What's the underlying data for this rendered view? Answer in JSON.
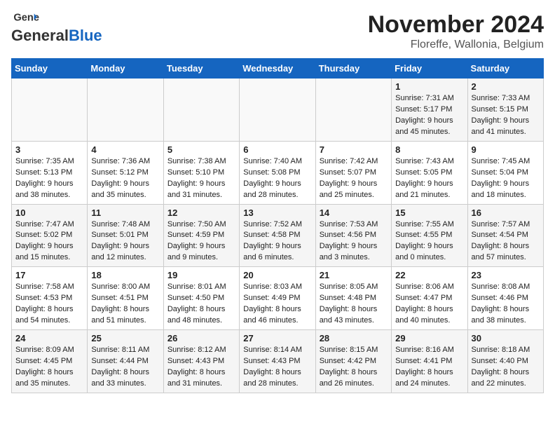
{
  "logo": {
    "general": "General",
    "blue": "Blue"
  },
  "title": "November 2024",
  "location": "Floreffe, Wallonia, Belgium",
  "days_of_week": [
    "Sunday",
    "Monday",
    "Tuesday",
    "Wednesday",
    "Thursday",
    "Friday",
    "Saturday"
  ],
  "weeks": [
    [
      {
        "day": "",
        "content": ""
      },
      {
        "day": "",
        "content": ""
      },
      {
        "day": "",
        "content": ""
      },
      {
        "day": "",
        "content": ""
      },
      {
        "day": "",
        "content": ""
      },
      {
        "day": "1",
        "content": "Sunrise: 7:31 AM\nSunset: 5:17 PM\nDaylight: 9 hours and 45 minutes."
      },
      {
        "day": "2",
        "content": "Sunrise: 7:33 AM\nSunset: 5:15 PM\nDaylight: 9 hours and 41 minutes."
      }
    ],
    [
      {
        "day": "3",
        "content": "Sunrise: 7:35 AM\nSunset: 5:13 PM\nDaylight: 9 hours and 38 minutes."
      },
      {
        "day": "4",
        "content": "Sunrise: 7:36 AM\nSunset: 5:12 PM\nDaylight: 9 hours and 35 minutes."
      },
      {
        "day": "5",
        "content": "Sunrise: 7:38 AM\nSunset: 5:10 PM\nDaylight: 9 hours and 31 minutes."
      },
      {
        "day": "6",
        "content": "Sunrise: 7:40 AM\nSunset: 5:08 PM\nDaylight: 9 hours and 28 minutes."
      },
      {
        "day": "7",
        "content": "Sunrise: 7:42 AM\nSunset: 5:07 PM\nDaylight: 9 hours and 25 minutes."
      },
      {
        "day": "8",
        "content": "Sunrise: 7:43 AM\nSunset: 5:05 PM\nDaylight: 9 hours and 21 minutes."
      },
      {
        "day": "9",
        "content": "Sunrise: 7:45 AM\nSunset: 5:04 PM\nDaylight: 9 hours and 18 minutes."
      }
    ],
    [
      {
        "day": "10",
        "content": "Sunrise: 7:47 AM\nSunset: 5:02 PM\nDaylight: 9 hours and 15 minutes."
      },
      {
        "day": "11",
        "content": "Sunrise: 7:48 AM\nSunset: 5:01 PM\nDaylight: 9 hours and 12 minutes."
      },
      {
        "day": "12",
        "content": "Sunrise: 7:50 AM\nSunset: 4:59 PM\nDaylight: 9 hours and 9 minutes."
      },
      {
        "day": "13",
        "content": "Sunrise: 7:52 AM\nSunset: 4:58 PM\nDaylight: 9 hours and 6 minutes."
      },
      {
        "day": "14",
        "content": "Sunrise: 7:53 AM\nSunset: 4:56 PM\nDaylight: 9 hours and 3 minutes."
      },
      {
        "day": "15",
        "content": "Sunrise: 7:55 AM\nSunset: 4:55 PM\nDaylight: 9 hours and 0 minutes."
      },
      {
        "day": "16",
        "content": "Sunrise: 7:57 AM\nSunset: 4:54 PM\nDaylight: 8 hours and 57 minutes."
      }
    ],
    [
      {
        "day": "17",
        "content": "Sunrise: 7:58 AM\nSunset: 4:53 PM\nDaylight: 8 hours and 54 minutes."
      },
      {
        "day": "18",
        "content": "Sunrise: 8:00 AM\nSunset: 4:51 PM\nDaylight: 8 hours and 51 minutes."
      },
      {
        "day": "19",
        "content": "Sunrise: 8:01 AM\nSunset: 4:50 PM\nDaylight: 8 hours and 48 minutes."
      },
      {
        "day": "20",
        "content": "Sunrise: 8:03 AM\nSunset: 4:49 PM\nDaylight: 8 hours and 46 minutes."
      },
      {
        "day": "21",
        "content": "Sunrise: 8:05 AM\nSunset: 4:48 PM\nDaylight: 8 hours and 43 minutes."
      },
      {
        "day": "22",
        "content": "Sunrise: 8:06 AM\nSunset: 4:47 PM\nDaylight: 8 hours and 40 minutes."
      },
      {
        "day": "23",
        "content": "Sunrise: 8:08 AM\nSunset: 4:46 PM\nDaylight: 8 hours and 38 minutes."
      }
    ],
    [
      {
        "day": "24",
        "content": "Sunrise: 8:09 AM\nSunset: 4:45 PM\nDaylight: 8 hours and 35 minutes."
      },
      {
        "day": "25",
        "content": "Sunrise: 8:11 AM\nSunset: 4:44 PM\nDaylight: 8 hours and 33 minutes."
      },
      {
        "day": "26",
        "content": "Sunrise: 8:12 AM\nSunset: 4:43 PM\nDaylight: 8 hours and 31 minutes."
      },
      {
        "day": "27",
        "content": "Sunrise: 8:14 AM\nSunset: 4:43 PM\nDaylight: 8 hours and 28 minutes."
      },
      {
        "day": "28",
        "content": "Sunrise: 8:15 AM\nSunset: 4:42 PM\nDaylight: 8 hours and 26 minutes."
      },
      {
        "day": "29",
        "content": "Sunrise: 8:16 AM\nSunset: 4:41 PM\nDaylight: 8 hours and 24 minutes."
      },
      {
        "day": "30",
        "content": "Sunrise: 8:18 AM\nSunset: 4:40 PM\nDaylight: 8 hours and 22 minutes."
      }
    ]
  ]
}
